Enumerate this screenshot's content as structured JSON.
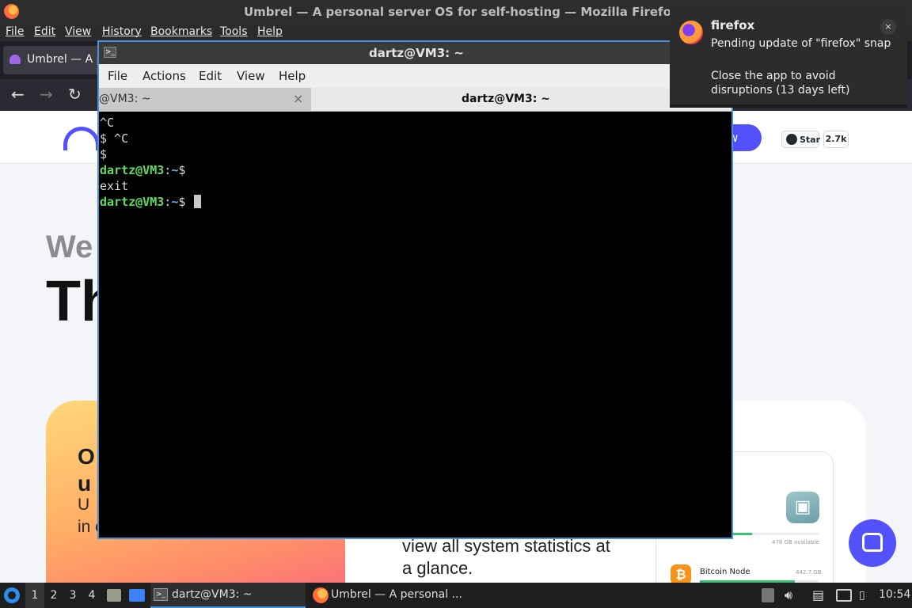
{
  "firefox": {
    "window_title": "Umbrel — A personal server OS for self-hosting — Mozilla Firefox",
    "menu": [
      "File",
      "Edit",
      "View",
      "History",
      "Bookmarks",
      "Tools",
      "Help"
    ],
    "tab_title": "Umbrel — A p",
    "nav": {
      "back": "←",
      "forward": "→",
      "reload": "↻"
    }
  },
  "page": {
    "cta_label": "w",
    "github_star_label": "Star",
    "github_star_count": "2.7k",
    "hero_welcome": "We",
    "hero_title": "Th",
    "card1_heading_line1": "O",
    "card1_heading_line2": "u",
    "card1_text_line1": "U",
    "card1_text_line2": "in one click.",
    "card2_text_line1": "view all system statistics at",
    "card2_text_line2": "a glance.",
    "widget": {
      "storage_available": "478 GB available",
      "storage_fraction": 0.59,
      "app_name": "Bitcoin Node",
      "app_size": "442.7 GB",
      "app_fraction": 0.8
    }
  },
  "terminal": {
    "window_title": "dartz@VM3: ~",
    "menu": [
      "File",
      "Actions",
      "Edit",
      "View",
      "Help"
    ],
    "tabs": [
      {
        "label": "@VM3: ~",
        "close": "×",
        "active": false
      },
      {
        "label": "dartz@VM3: ~",
        "active": true
      }
    ],
    "lines": [
      {
        "text": "^C"
      },
      {
        "text": "$ ^C"
      },
      {
        "text": "$"
      },
      {
        "user": "dartz@VM3",
        "sep": ":",
        "path": "~",
        "tail": "$"
      },
      {
        "text": "exit"
      },
      {
        "user": "dartz@VM3",
        "sep": ":",
        "path": "~",
        "tail": "$ "
      }
    ]
  },
  "notification": {
    "app": "firefox",
    "message": "Pending update of \"firefox\" snap",
    "detail": "Close the app to avoid disruptions (13 days left)",
    "close": "×"
  },
  "taskbar": {
    "workspaces": [
      "1",
      "2",
      "3",
      "4"
    ],
    "active_workspace": "1",
    "tasks": [
      {
        "label": "dartz@VM3: ~",
        "active": true
      },
      {
        "label": "Umbrel — A personal ..."
      }
    ],
    "clock": "10:54"
  },
  "colors": {
    "accent": "#5351fb",
    "terminal_border": "#4a90d9",
    "prompt_user": "#5fdb5f",
    "prompt_path": "#6fa8ff"
  }
}
